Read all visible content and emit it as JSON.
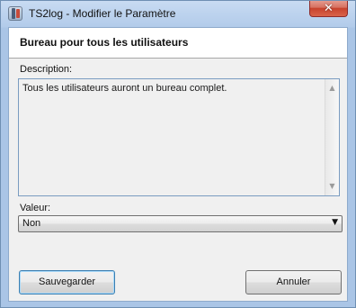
{
  "window": {
    "title": "TS2log - Modifier le Paramètre"
  },
  "icons": {
    "app": "ts2log-app-icon",
    "close": "close-icon",
    "scroll_up": "scroll-up-icon",
    "scroll_down": "scroll-down-icon",
    "dropdown": "chevron-down-icon"
  },
  "dialog": {
    "parameter_title": "Bureau pour tous les utilisateurs",
    "description_label": "Description:",
    "description_text": "Tous les utilisateurs auront un bureau complet.",
    "value_label": "Valeur:",
    "selected_value": "Non",
    "save_button": "Sauvegarder",
    "cancel_button": "Annuler"
  },
  "controls": {
    "close_glyph": "✕",
    "scroll_up_glyph": "▲",
    "scroll_down_glyph": "▼",
    "dropdown_glyph": "▼"
  },
  "colors": {
    "window_frame": "#aac5e6",
    "close_button": "#c7412c",
    "primary_focus": "#3c7fb1"
  }
}
